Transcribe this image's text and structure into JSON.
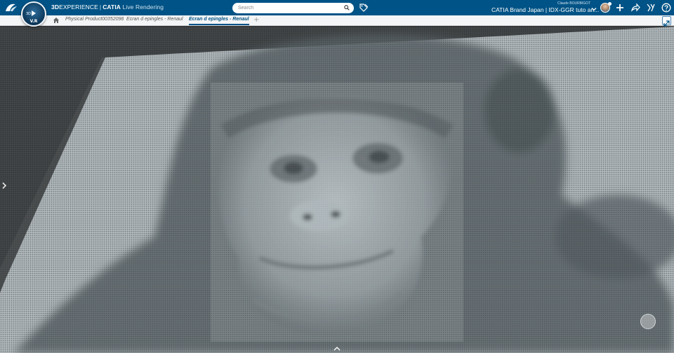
{
  "app": {
    "brand_bold": "3D",
    "brand_rest": "EXPERIENCE",
    "brand_app": "CATIA",
    "brand_module": "Live Rendering",
    "compass_version": "V.R",
    "compass_quadrant_3d": "3D"
  },
  "search": {
    "placeholder": "Search"
  },
  "user": {
    "name": "Claude BOURBIGOT"
  },
  "space": {
    "title": "CATIA Brand Japan | IDX-GGR tuto an..."
  },
  "toolbar_icons": [
    "tag-icon",
    "chevron-down-icon",
    "avatar",
    "add-icon",
    "share-icon",
    "collaboration-icon",
    "help-icon"
  ],
  "tabs": [
    {
      "label": "Physical Product00352098"
    },
    {
      "label": "Ecran d epingles - Renaul"
    },
    {
      "label": "Ecran d epingles - Renaul"
    }
  ],
  "tab_add_label": "+",
  "colors": {
    "topbar": "#005386",
    "tabbar": "#f4f5f6",
    "viewport_bg": "#2b2b2b",
    "pin_light": "#dfe3e5",
    "pin_dark": "#4b5357"
  }
}
